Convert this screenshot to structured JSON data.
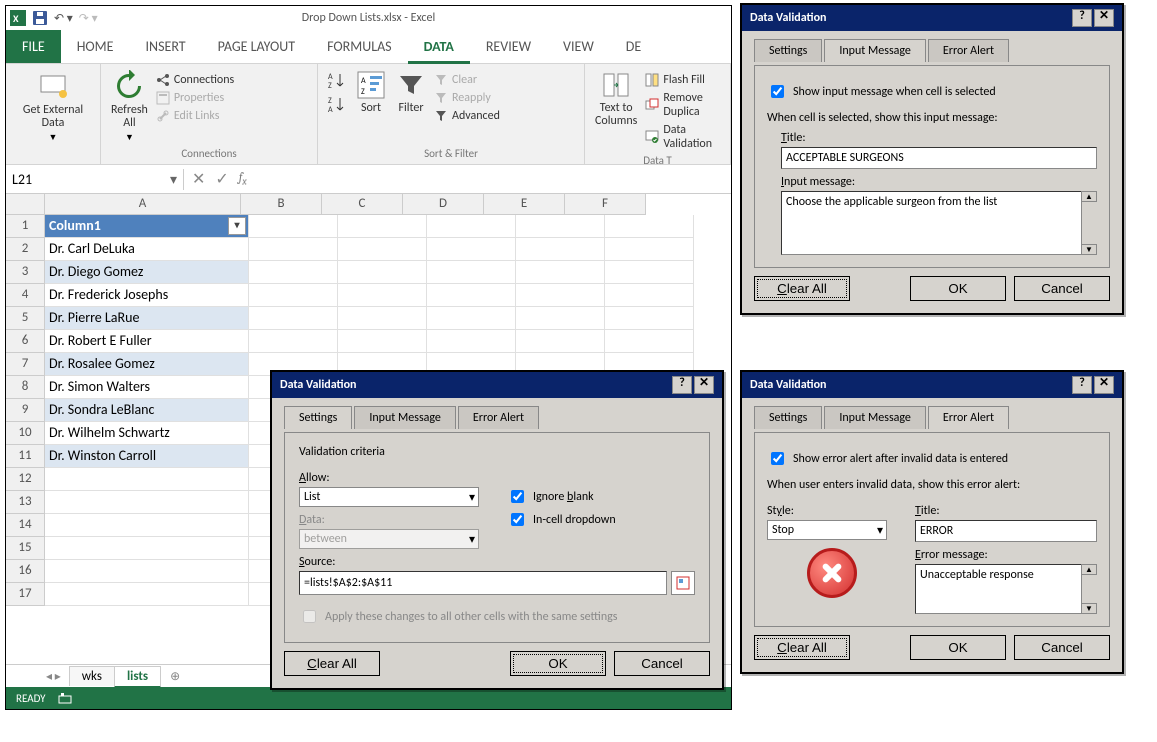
{
  "window_title": "Drop Down Lists.xlsx - Excel",
  "tabs": {
    "file": "FILE",
    "home": "HOME",
    "insert": "INSERT",
    "page": "PAGE LAYOUT",
    "formulas": "FORMULAS",
    "data": "DATA",
    "review": "REVIEW",
    "view": "VIEW",
    "dev": "DE"
  },
  "ribbon": {
    "get_external": "Get External\nData",
    "refresh": "Refresh\nAll",
    "connections": "Connections",
    "properties": "Properties",
    "edit_links": "Edit Links",
    "conn_group": "Connections",
    "sort": "Sort",
    "filter": "Filter",
    "clear": "Clear",
    "reapply": "Reapply",
    "advanced": "Advanced",
    "sortfilter_group": "Sort & Filter",
    "t2c": "Text to\nColumns",
    "flash": "Flash Fill",
    "removedup": "Remove Duplica",
    "dataval": "Data Validation",
    "data_group": "Data T"
  },
  "namebox": "L21",
  "columns": [
    "A",
    "B",
    "C",
    "D",
    "E",
    "F"
  ],
  "header_cell": "Column1",
  "rows": [
    "Dr. Carl DeLuka",
    "Dr. Diego Gomez",
    "Dr. Frederick Josephs",
    "Dr. Pierre LaRue",
    "Dr. Robert E Fuller",
    "Dr. Rosalee Gomez",
    "Dr. Simon Walters",
    "Dr. Sondra LeBlanc",
    "Dr. Wilhelm Schwartz",
    "Dr. Winston Carroll"
  ],
  "sheets": {
    "wks": "wks",
    "lists": "lists"
  },
  "status": "READY",
  "dlg": {
    "title": "Data Validation",
    "tabs": {
      "settings": "Settings",
      "input": "Input Message",
      "error": "Error Alert"
    },
    "clear": "Clear All",
    "ok": "OK",
    "cancel": "Cancel",
    "settings": {
      "legend": "Validation criteria",
      "allow_label": "Allow:",
      "allow_value": "List",
      "ignore_blank": "Ignore blank",
      "incell": "In-cell dropdown",
      "data_label": "Data:",
      "data_value": "between",
      "source_label": "Source:",
      "source_value": "=lists!$A$2:$A$11",
      "apply": "Apply these changes to all other cells with the same settings"
    },
    "input": {
      "show": "Show input message when cell is selected",
      "when": "When cell is selected, show this input message:",
      "title_label": "Title:",
      "title_value": "ACCEPTABLE SURGEONS",
      "msg_label": "Input message:",
      "msg_value": "Choose the applicable surgeon from the list"
    },
    "error": {
      "show": "Show error alert after invalid data is entered",
      "when": "When user enters invalid data, show this error alert:",
      "style_label": "Style:",
      "style_value": "Stop",
      "title_label": "Title:",
      "title_value": "ERROR",
      "msg_label": "Error message:",
      "msg_value": "Unacceptable response"
    }
  }
}
